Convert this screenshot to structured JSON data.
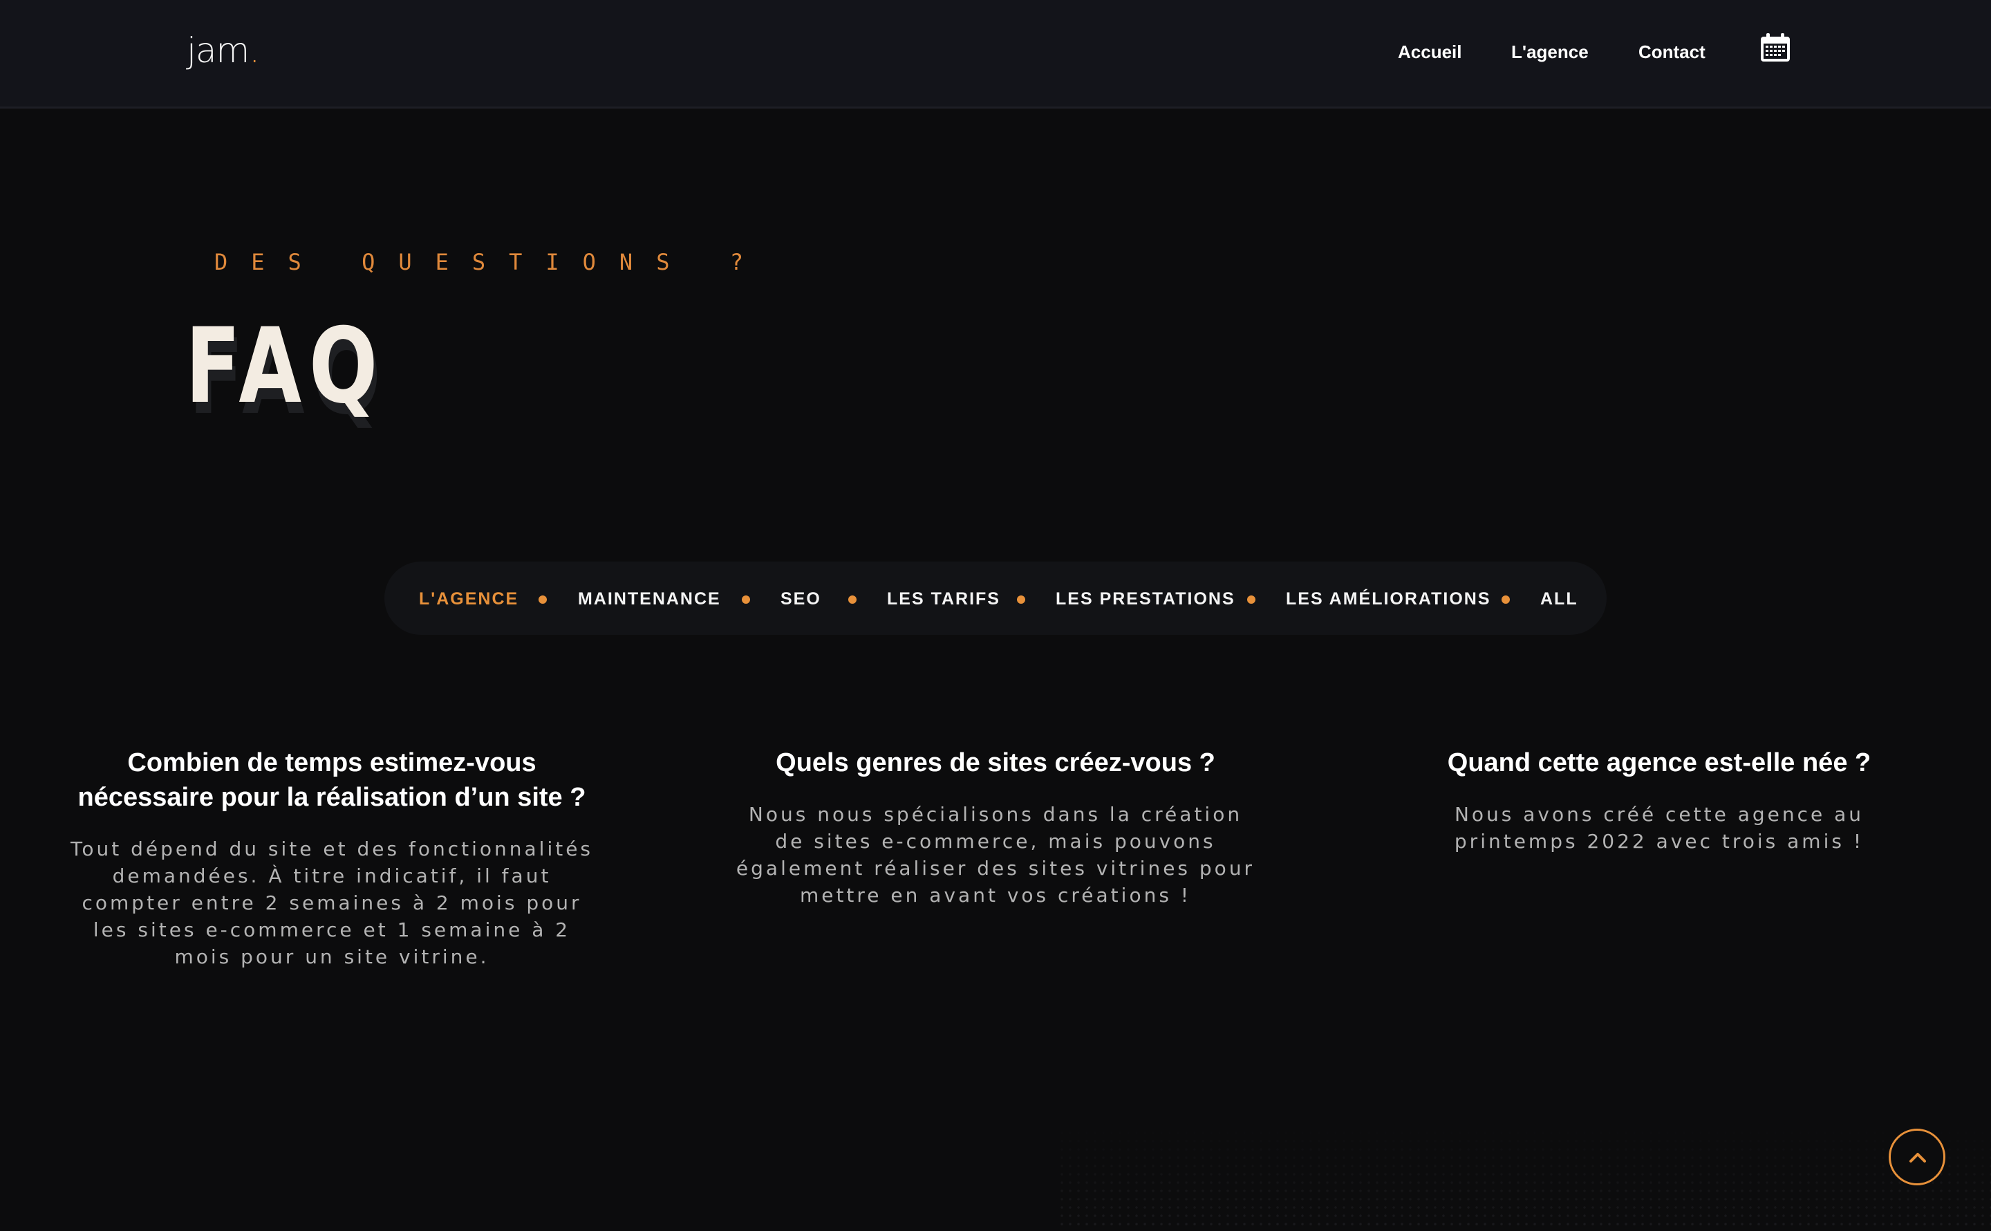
{
  "header": {
    "logo_text": "jam",
    "logo_dot": ".",
    "nav": [
      {
        "label": "Accueil"
      },
      {
        "label": "L'agence"
      },
      {
        "label": "Contact"
      }
    ],
    "calendar_icon": "calendar-icon"
  },
  "hero": {
    "kicker": "DES QUESTIONS ?",
    "title": "FAQ"
  },
  "filters": {
    "items": [
      {
        "label": "L'AGENCE",
        "active": true
      },
      {
        "label": "MAINTENANCE",
        "active": false
      },
      {
        "label": "SEO",
        "active": false
      },
      {
        "label": "LES TARIFS",
        "active": false
      },
      {
        "label": "LES PRESTATIONS",
        "active": false
      },
      {
        "label": "LES AMÉLIORATIONS",
        "active": false
      },
      {
        "label": "ALL",
        "active": false
      }
    ],
    "separator_icon": "dot-separator"
  },
  "faq": [
    {
      "question": "Combien de temps estimez-vous nécessaire pour la réalisation d’un site ?",
      "answer": "Tout dépend du site et des fonctionnalités demandées. À titre indicatif, il faut compter entre 2 semaines à 2 mois pour les sites e-commerce et 1 semaine à 2 mois pour un site vitrine."
    },
    {
      "question": "Quels genres de sites créez-vous ?",
      "answer": "Nous nous spécialisons dans la création de sites e-commerce, mais pouvons également réaliser des sites vitrines pour mettre en avant vos créations !"
    },
    {
      "question": "Quand cette agence est-elle née ?",
      "answer": "Nous avons créé cette agence au printemps 2022 avec trois amis !"
    }
  ],
  "scroll_top_icon": "chevron-up-icon",
  "colors": {
    "accent": "#e8913a",
    "background": "#0c0c0d",
    "header_bg": "#13141a",
    "title": "#f3ece2",
    "body_text": "#b3b3b3"
  }
}
